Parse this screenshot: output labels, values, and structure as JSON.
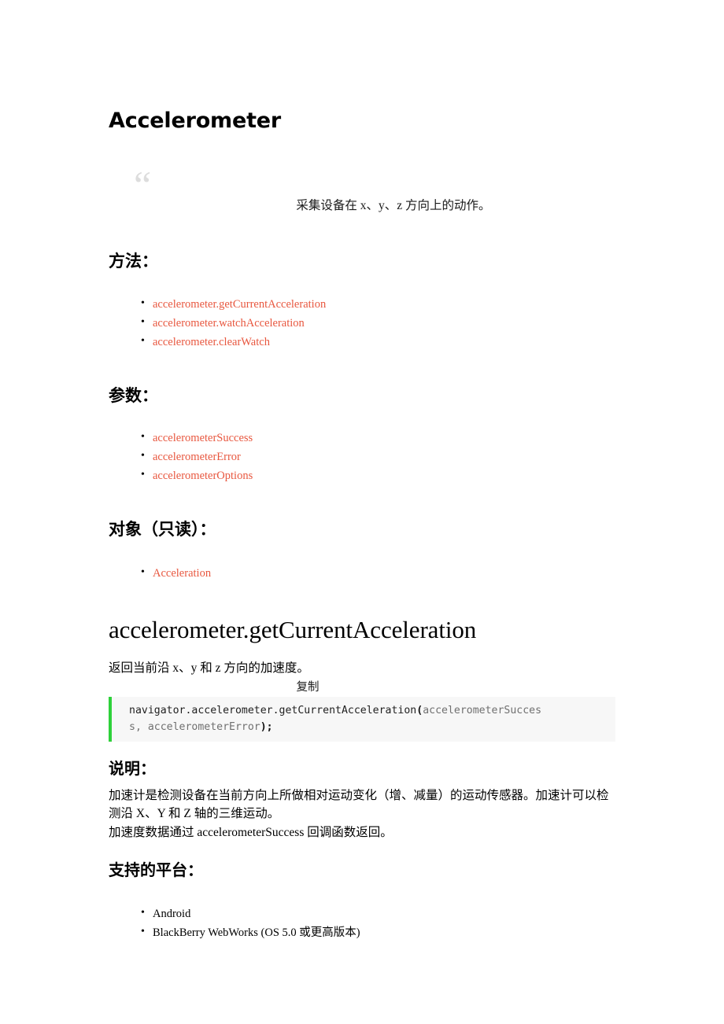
{
  "document": {
    "title": "Accelerometer",
    "quote": {
      "mark": "“",
      "text": "采集设备在 x、y、z 方向上的动作。"
    },
    "sections": {
      "methods": {
        "heading": "方法：",
        "items": [
          "accelerometer.getCurrentAcceleration",
          "accelerometer.watchAcceleration",
          "accelerometer.clearWatch"
        ]
      },
      "parameters": {
        "heading": "参数：",
        "items": [
          "accelerometerSuccess",
          "accelerometerError",
          "accelerometerOptions"
        ]
      },
      "objects": {
        "heading": "对象（只读）：",
        "items": [
          "Acceleration"
        ]
      }
    },
    "api": {
      "heading": "accelerometer.getCurrentAcceleration",
      "lead": "返回当前沿 x、y 和 z 方向的加速度。",
      "copy_label": "复制",
      "code": {
        "line1_a": "navigator.accelerometer.getCurrentAcceleration",
        "line1_b": "(",
        "line1_c": "accelerometerSucces",
        "line2_a": "s, accelerometerError",
        "line2_b": ");"
      },
      "description": {
        "heading": "说明：",
        "paragraph1": "加速计是检测设备在当前方向上所做相对运动变化（增、减量）的运动传感器。加速计可以检测沿 X、Y 和 Z 轴的三维运动。",
        "paragraph2": "加速度数据通过 accelerometerSuccess 回调函数返回。"
      },
      "platforms": {
        "heading": "支持的平台：",
        "items": [
          "Android",
          "BlackBerry WebWorks (OS 5.0 或更高版本)"
        ]
      }
    },
    "colors": {
      "link": "#e8573f",
      "code_border": "#2ed13a",
      "code_background": "#f7f7f7",
      "quote_mark": "#dddddd",
      "text": "#000000"
    }
  }
}
